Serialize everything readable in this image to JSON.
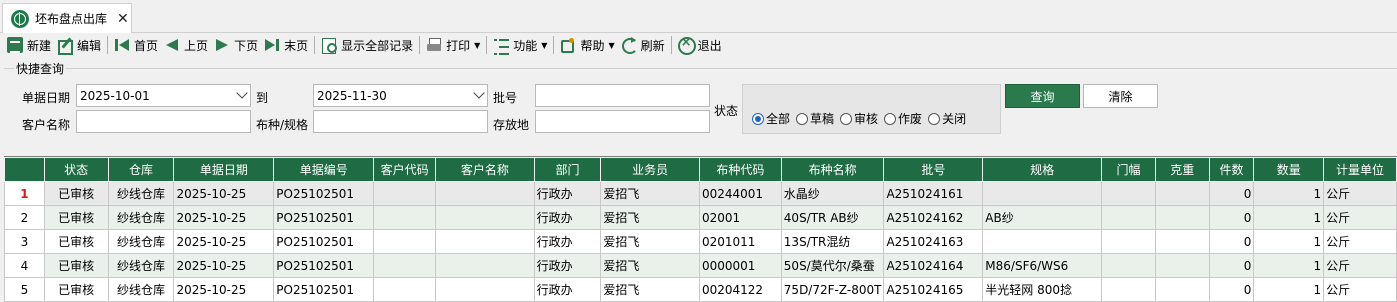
{
  "tab": {
    "title": "坯布盘点出库",
    "close": "✕"
  },
  "toolbar": {
    "new": "新建",
    "edit": "编辑",
    "first": "首页",
    "prev": "上页",
    "next": "下页",
    "last": "末页",
    "show_all": "显示全部记录",
    "print": "打印",
    "function": "功能",
    "help": "帮助",
    "refresh": "刷新",
    "exit": "退出"
  },
  "query": {
    "legend": "快捷查询",
    "date_label": "单据日期",
    "date_from": "2025-10-01",
    "to_label": "到",
    "date_to": "2025-11-30",
    "batch_label": "批号",
    "batch_value": "",
    "customer_label": "客户名称",
    "customer_value": "",
    "spec_label": "布种/规格",
    "spec_value": "",
    "storage_label": "存放地",
    "storage_value": "",
    "status_label": "状态",
    "status_options": [
      "全部",
      "草稿",
      "审核",
      "作废",
      "关闭"
    ],
    "status_selected": "全部",
    "query_button": "查询",
    "clear_button": "清除"
  },
  "grid": {
    "headers": [
      "",
      "状态",
      "仓库",
      "单据日期",
      "单据编号",
      "客户代码",
      "客户名称",
      "部门",
      "业务员",
      "布种代码",
      "布种名称",
      "批号",
      "规格",
      "门幅",
      "克重",
      "件数",
      "数量",
      "计量单位"
    ],
    "rows": [
      {
        "no": "1",
        "status": "已审核",
        "warehouse": "纱线仓库",
        "date": "2025-10-25",
        "doc_no": "PO25102501",
        "cust_code": "",
        "cust_name": "",
        "dept": "行政办",
        "salesman": "爱招飞",
        "fabric_code": "00244001",
        "fabric_name": "水晶纱",
        "batch": "A251024161",
        "spec": "",
        "width": "",
        "weight": "",
        "pieces": "0",
        "qty": "1",
        "unit": "公斤"
      },
      {
        "no": "2",
        "status": "已审核",
        "warehouse": "纱线仓库",
        "date": "2025-10-25",
        "doc_no": "PO25102501",
        "cust_code": "",
        "cust_name": "",
        "dept": "行政办",
        "salesman": "爱招飞",
        "fabric_code": "02001",
        "fabric_name": "40S/TR AB纱",
        "batch": "A251024162",
        "spec": "AB纱",
        "width": "",
        "weight": "",
        "pieces": "0",
        "qty": "1",
        "unit": "公斤"
      },
      {
        "no": "3",
        "status": "已审核",
        "warehouse": "纱线仓库",
        "date": "2025-10-25",
        "doc_no": "PO25102501",
        "cust_code": "",
        "cust_name": "",
        "dept": "行政办",
        "salesman": "爱招飞",
        "fabric_code": "0201011",
        "fabric_name": "13S/TR混纺",
        "batch": "A251024163",
        "spec": "",
        "width": "",
        "weight": "",
        "pieces": "0",
        "qty": "1",
        "unit": "公斤"
      },
      {
        "no": "4",
        "status": "已审核",
        "warehouse": "纱线仓库",
        "date": "2025-10-25",
        "doc_no": "PO25102501",
        "cust_code": "",
        "cust_name": "",
        "dept": "行政办",
        "salesman": "爱招飞",
        "fabric_code": "0000001",
        "fabric_name": "50S/莫代尔/桑蚕",
        "batch": "A251024164",
        "spec": "M86/SF6/WS6",
        "width": "",
        "weight": "",
        "pieces": "0",
        "qty": "1",
        "unit": "公斤"
      },
      {
        "no": "5",
        "status": "已审核",
        "warehouse": "纱线仓库",
        "date": "2025-10-25",
        "doc_no": "PO25102501",
        "cust_code": "",
        "cust_name": "",
        "dept": "行政办",
        "salesman": "爱招飞",
        "fabric_code": "00204122",
        "fabric_name": "75D/72F-Z-800T",
        "batch": "A251024165",
        "spec": "半光轻网  800捻",
        "width": "",
        "weight": "",
        "pieces": "0",
        "qty": "1",
        "unit": "公斤"
      }
    ]
  },
  "colors": {
    "header_green": "#1f6b43",
    "query_button": "#2a7a4e",
    "row_highlight": "#e9f1ea",
    "row_number_active": "#d21e1e"
  }
}
